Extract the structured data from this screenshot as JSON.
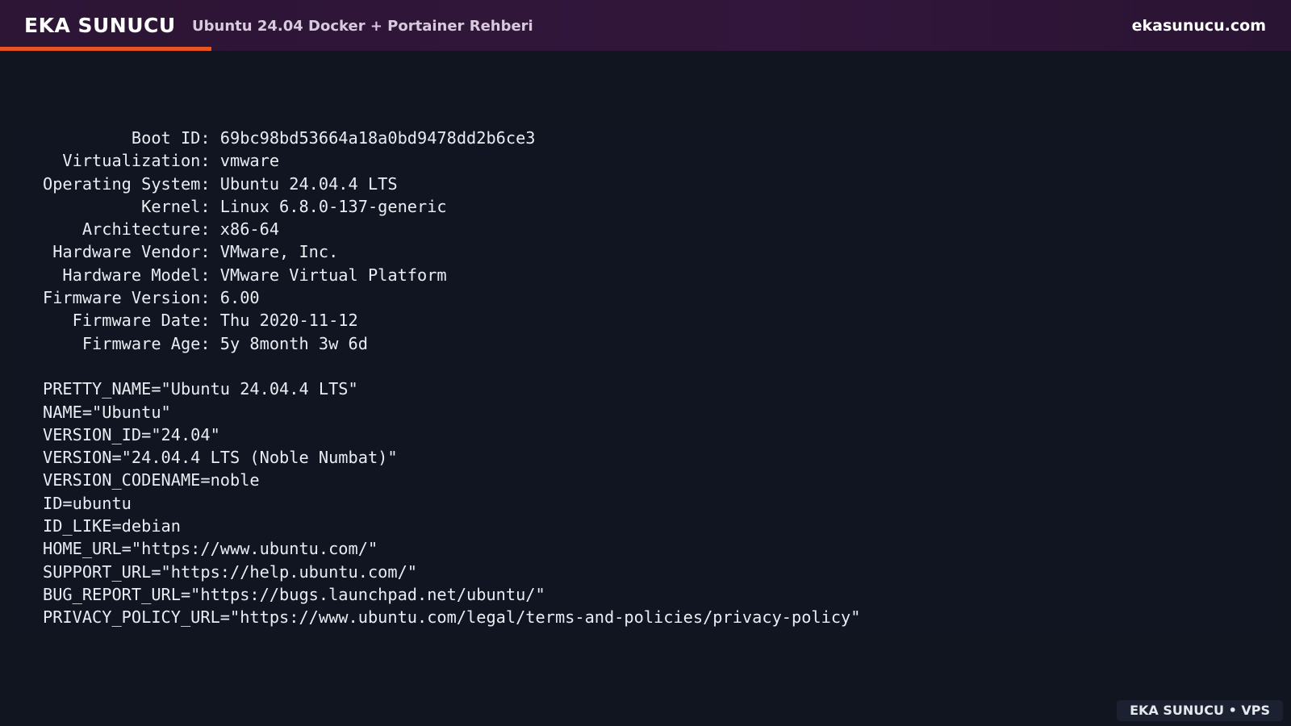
{
  "header": {
    "brand": "EKA SUNUCU",
    "subtitle": "Ubuntu 24.04 Docker + Portainer Rehberi",
    "site": "ekasunucu.com",
    "accent_color": "#e95420"
  },
  "terminal": {
    "lines": [
      "         Boot ID: 69bc98bd53664a18a0bd9478dd2b6ce3",
      "  Virtualization: vmware",
      "Operating System: Ubuntu 24.04.4 LTS",
      "          Kernel: Linux 6.8.0-137-generic",
      "    Architecture: x86-64",
      " Hardware Vendor: VMware, Inc.",
      "  Hardware Model: VMware Virtual Platform",
      "Firmware Version: 6.00",
      "   Firmware Date: Thu 2020-11-12",
      "    Firmware Age: 5y 8month 3w 6d",
      "",
      "PRETTY_NAME=\"Ubuntu 24.04.4 LTS\"",
      "NAME=\"Ubuntu\"",
      "VERSION_ID=\"24.04\"",
      "VERSION=\"24.04.4 LTS (Noble Numbat)\"",
      "VERSION_CODENAME=noble",
      "ID=ubuntu",
      "ID_LIKE=debian",
      "HOME_URL=\"https://www.ubuntu.com/\"",
      "SUPPORT_URL=\"https://help.ubuntu.com/\"",
      "BUG_REPORT_URL=\"https://bugs.launchpad.net/ubuntu/\"",
      "PRIVACY_POLICY_URL=\"https://www.ubuntu.com/legal/terms-and-policies/privacy-policy\""
    ]
  },
  "footer": {
    "badge": "EKA SUNUCU • VPS"
  }
}
